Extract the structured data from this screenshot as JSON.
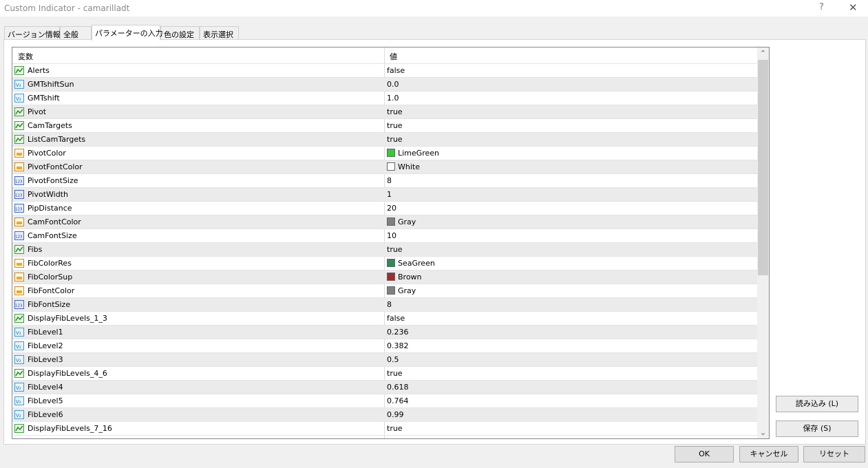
{
  "window": {
    "title": "Custom Indicator - camarilladt",
    "help": "?",
    "close": "✕"
  },
  "tabs": [
    "バージョン情報",
    "全般",
    "パラメーターの入力",
    "色の設定",
    "表示選択"
  ],
  "grid": {
    "col_name": "変数",
    "col_value": "値",
    "rows": [
      {
        "icon": "bool",
        "name": "Alerts",
        "value": "false"
      },
      {
        "icon": "double",
        "name": "GMTshiftSun",
        "value": "0.0"
      },
      {
        "icon": "double",
        "name": "GMTshift",
        "value": "1.0"
      },
      {
        "icon": "bool",
        "name": "Pivot",
        "value": "true"
      },
      {
        "icon": "bool",
        "name": "CamTargets",
        "value": "true"
      },
      {
        "icon": "bool",
        "name": "ListCamTargets",
        "value": "true"
      },
      {
        "icon": "color",
        "name": "PivotColor",
        "value": "LimeGreen",
        "swatch": "#32cd32"
      },
      {
        "icon": "color",
        "name": "PivotFontColor",
        "value": "White",
        "swatch": "#ffffff"
      },
      {
        "icon": "int",
        "name": "PivotFontSize",
        "value": "8"
      },
      {
        "icon": "int",
        "name": "PivotWidth",
        "value": "1"
      },
      {
        "icon": "int",
        "name": "PipDistance",
        "value": "20"
      },
      {
        "icon": "color",
        "name": "CamFontColor",
        "value": "Gray",
        "swatch": "#808080"
      },
      {
        "icon": "int",
        "name": "CamFontSize",
        "value": "10"
      },
      {
        "icon": "bool",
        "name": "Fibs",
        "value": "true"
      },
      {
        "icon": "color",
        "name": "FibColorRes",
        "value": "SeaGreen",
        "swatch": "#2e8b57"
      },
      {
        "icon": "color",
        "name": "FibColorSup",
        "value": "Brown",
        "swatch": "#a52a2a"
      },
      {
        "icon": "color",
        "name": "FibFontColor",
        "value": "Gray",
        "swatch": "#808080"
      },
      {
        "icon": "int",
        "name": "FibFontSize",
        "value": "8"
      },
      {
        "icon": "bool",
        "name": "DisplayFibLevels_1_3",
        "value": "false"
      },
      {
        "icon": "double",
        "name": "FibLevel1",
        "value": "0.236"
      },
      {
        "icon": "double",
        "name": "FibLevel2",
        "value": "0.382"
      },
      {
        "icon": "double",
        "name": "FibLevel3",
        "value": "0.5"
      },
      {
        "icon": "bool",
        "name": "DisplayFibLevels_4_6",
        "value": "true"
      },
      {
        "icon": "double",
        "name": "FibLevel4",
        "value": "0.618"
      },
      {
        "icon": "double",
        "name": "FibLevel5",
        "value": "0.764"
      },
      {
        "icon": "double",
        "name": "FibLevel6",
        "value": "0.99"
      },
      {
        "icon": "bool",
        "name": "DisplayFibLevels_7_16",
        "value": "true"
      }
    ]
  },
  "buttons": {
    "load": "読み込み (L)",
    "save": "保存 (S)",
    "ok": "OK",
    "cancel": "キャンセル",
    "reset": "リセット"
  }
}
